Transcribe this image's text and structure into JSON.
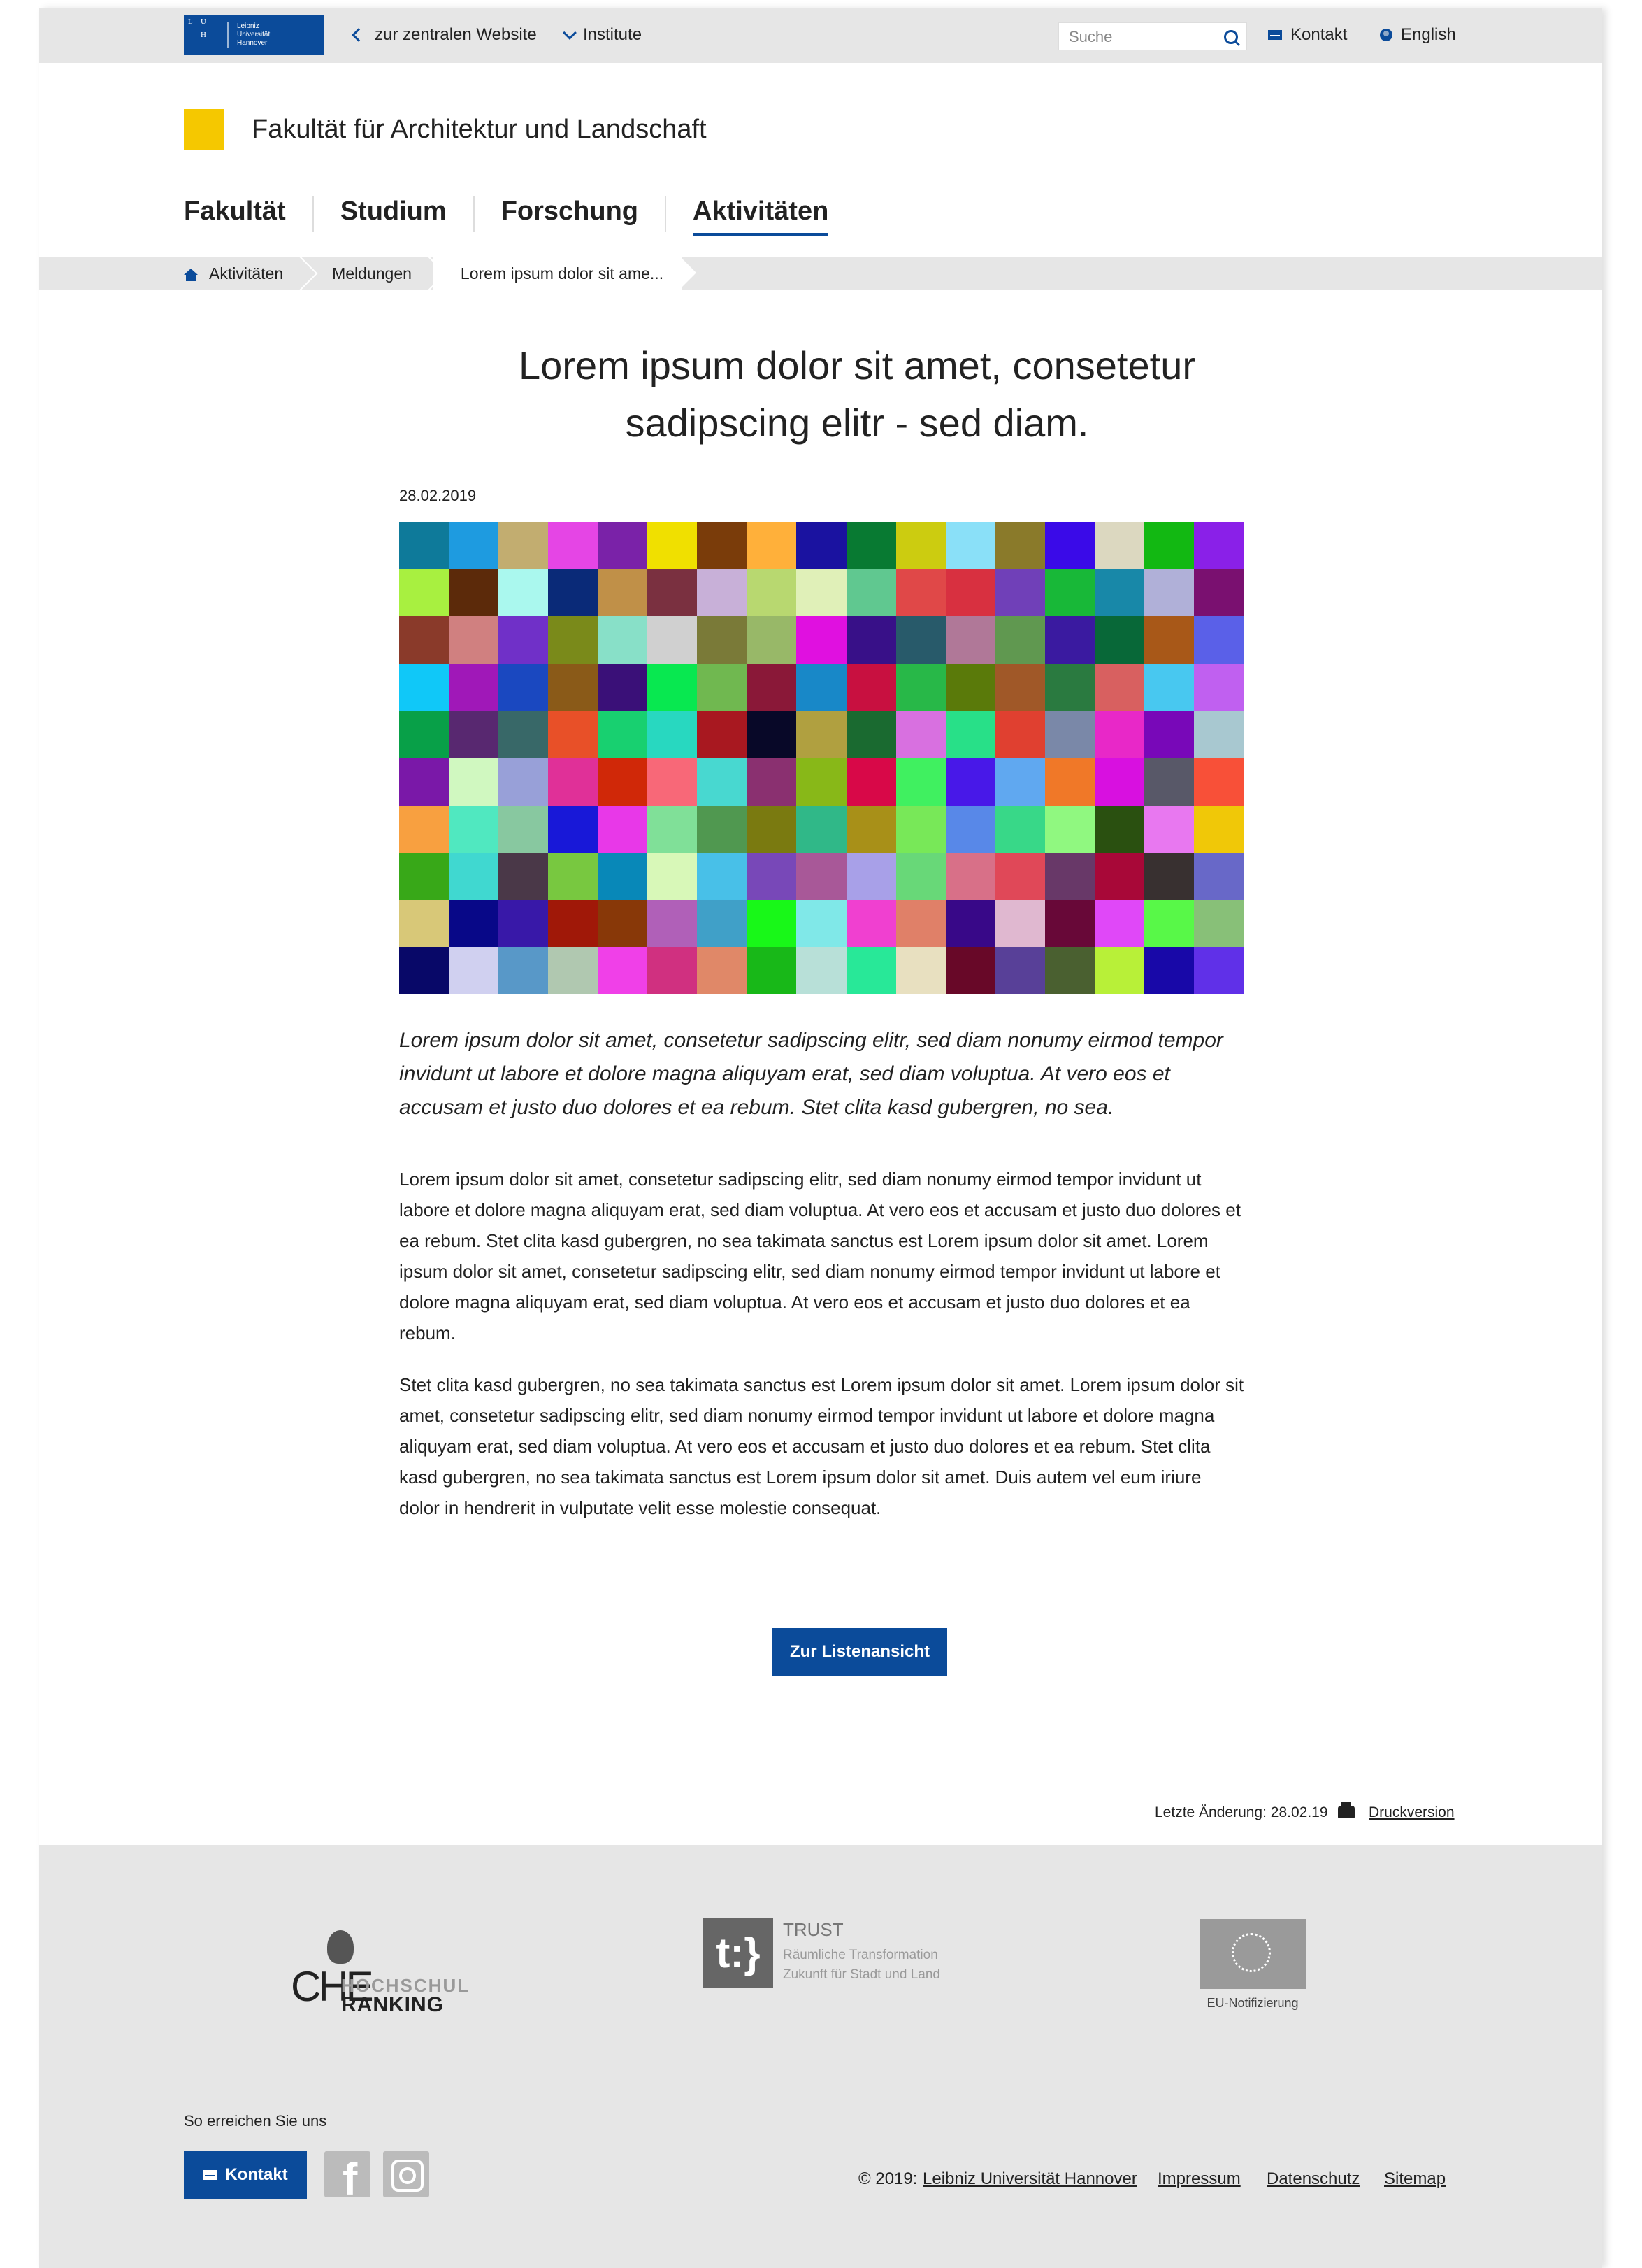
{
  "topbar": {
    "logo": {
      "mark": [
        "L",
        "U",
        "",
        "",
        "H",
        "",
        "",
        "",
        ""
      ],
      "lines": [
        "Leibniz",
        "Universität",
        "Hannover"
      ]
    },
    "back_link": "zur zentralen Website",
    "institutes": "Institute",
    "search_placeholder": "Suche",
    "contact": "Kontakt",
    "language": "English"
  },
  "faculty": {
    "title": "Fakultät für Architektur und Landschaft"
  },
  "nav": [
    {
      "label": "Fakultät",
      "active": false
    },
    {
      "label": "Studium",
      "active": false
    },
    {
      "label": "Forschung",
      "active": false
    },
    {
      "label": "Aktivitäten",
      "active": true
    }
  ],
  "breadcrumb": [
    "Aktivitäten",
    "Meldungen",
    "Lorem ipsum dolor sit ame..."
  ],
  "article": {
    "title_line1": "Lorem ipsum dolor sit amet, consetetur",
    "title_line2": "sadipscing elitr - sed diam.",
    "date": "28.02.2019",
    "lead": "Lorem ipsum dolor sit amet, consetetur sadipscing elitr, sed diam nonumy eirmod tempor invidunt ut labore et dolore magna aliquyam erat, sed diam voluptua. At vero eos et accusam et justo duo dolores et ea rebum. Stet clita kasd gubergren, no sea.",
    "paragraph1": "Lorem ipsum dolor sit amet, consetetur sadipscing elitr, sed diam nonumy eirmod tempor invidunt ut labore et dolore magna aliquyam erat, sed diam voluptua. At vero eos et accusam et justo duo dolores et ea rebum. Stet clita kasd gubergren, no sea takimata sanctus est Lorem ipsum dolor sit amet. Lorem ipsum dolor sit amet, consetetur sadipscing elitr, sed diam nonumy eirmod tempor invidunt ut labore et dolore magna aliquyam erat, sed diam voluptua. At vero eos et accusam et justo duo dolores et ea rebum.",
    "paragraph2": "Stet clita kasd gubergren, no sea takimata sanctus est Lorem ipsum dolor sit amet. Lorem ipsum dolor sit amet, consetetur sadipscing elitr, sed diam nonumy eirmod tempor invidunt ut labore et dolore magna aliquyam erat, sed diam voluptua. At vero eos et accusam et justo duo dolores et ea rebum. Stet clita kasd gubergren, no sea takimata sanctus est Lorem ipsum dolor sit amet. Duis autem vel eum iriure dolor in hendrerit in vulputate velit esse molestie consequat.",
    "list_button": "Zur Listenansicht"
  },
  "mosaic_colors": [
    "#0e7a9a",
    "#1e9be0",
    "#c2ad70",
    "#e545e5",
    "#7a22a8",
    "#f0e000",
    "#7a3c0a",
    "#ffb03a",
    "#1a12a0",
    "#087a32",
    "#cccc10",
    "#8ae0f8",
    "#8a7a2a",
    "#3a0ae8",
    "#dcd8c0",
    "#12b812",
    "#8a20e8",
    "#a8f040",
    "#5c2a0a",
    "#aaf8ee",
    "#0a2a78",
    "#c09048",
    "#7a3040",
    "#c8b0d8",
    "#b8d870",
    "#e0f0b8",
    "#60c890",
    "#e04848",
    "#d83040",
    "#7040b8",
    "#18b838",
    "#1888a8",
    "#b0b0d8",
    "#7a1070",
    "#8a3a2a",
    "#d08080",
    "#7030c8",
    "#7a8a1a",
    "#88e0c8",
    "#d0d0d0",
    "#7a7a38",
    "#98b868",
    "#e010e0",
    "#381088",
    "#285a6a",
    "#b07898",
    "#609850",
    "#3a1aa0",
    "#086838",
    "#a85818",
    "#5a60e8",
    "#10c8f8",
    "#a018b8",
    "#1a48c0",
    "#8a5a18",
    "#3a1078",
    "#08e850",
    "#70b850",
    "#8a1838",
    "#1888c8",
    "#c81040",
    "#28b848",
    "#5a7a0a",
    "#a05828",
    "#2a7a40",
    "#d86060",
    "#48c8f0",
    "#c060f0",
    "#08a048",
    "#582870",
    "#386868",
    "#e85028",
    "#18d070",
    "#28d8c0",
    "#a81820",
    "#080828",
    "#b0a040",
    "#1a6a30",
    "#d870e0",
    "#28e088",
    "#e04030",
    "#7a88a8",
    "#e828c8",
    "#7808b8",
    "#a8c8d0",
    "#7a18a8",
    "#d0f8c0",
    "#98a0d8",
    "#e03098",
    "#d02808",
    "#f86878",
    "#48d8d0",
    "#8a3070",
    "#88b818",
    "#d80848",
    "#40f060",
    "#4818e8",
    "#60a8f0",
    "#f07828",
    "#d810e0",
    "#585868",
    "#f85038",
    "#f8a040",
    "#50e8c0",
    "#88c8a0",
    "#1818d8",
    "#e838e8",
    "#80e098",
    "#509850",
    "#7a7a10",
    "#30b888",
    "#a89018",
    "#78e858",
    "#5888e8",
    "#38d888",
    "#90f880",
    "#2a5010",
    "#e878f0",
    "#f0c808",
    "#38a818",
    "#40d8d0",
    "#4a3848",
    "#78c840",
    "#0888b8",
    "#d8f8b8",
    "#48c0e8",
    "#7848b8",
    "#a85898",
    "#a8a0e8",
    "#68d878",
    "#d87088",
    "#e04858",
    "#683868",
    "#a80838",
    "#383030",
    "#6868c8",
    "#d8c878",
    "#080888",
    "#3818a8",
    "#a01808",
    "#883808",
    "#b060b8",
    "#40a0c8",
    "#18f818",
    "#80e8e8",
    "#f040d0",
    "#e08068",
    "#380888",
    "#e0b8d0",
    "#680838",
    "#e048f8",
    "#58f848",
    "#88c078",
    "#080868",
    "#d0d0f0",
    "#5898c8",
    "#b0c8b0",
    "#f040e8",
    "#d03080",
    "#e08868",
    "#18b818",
    "#b8e0d8",
    "#28e898",
    "#e8e0c0",
    "#680828",
    "#584098",
    "#4a6030",
    "#b8f038",
    "#1808a8",
    "#6030e8"
  ],
  "meta": {
    "last_change": "Letzte Änderung: 28.02.19",
    "print": "Druckversion"
  },
  "footer": {
    "che": {
      "che": "CHE",
      "hochschul": "HOCHSCHUL",
      "ranking": "RANKING"
    },
    "trust": {
      "mark": "t:}",
      "title": "TRUST",
      "sub1": "Räumliche Transformation",
      "sub2": "Zukunft für Stadt und Land"
    },
    "eu_label": "EU-Notifizierung",
    "reach": "So erreichen Sie uns",
    "contact_button": "Kontakt",
    "facebook": "f",
    "copyright_prefix": "© 2019:",
    "university": "Leibniz Universität Hannover",
    "impressum": "Impressum",
    "datenschutz": "Datenschutz",
    "sitemap": "Sitemap"
  }
}
